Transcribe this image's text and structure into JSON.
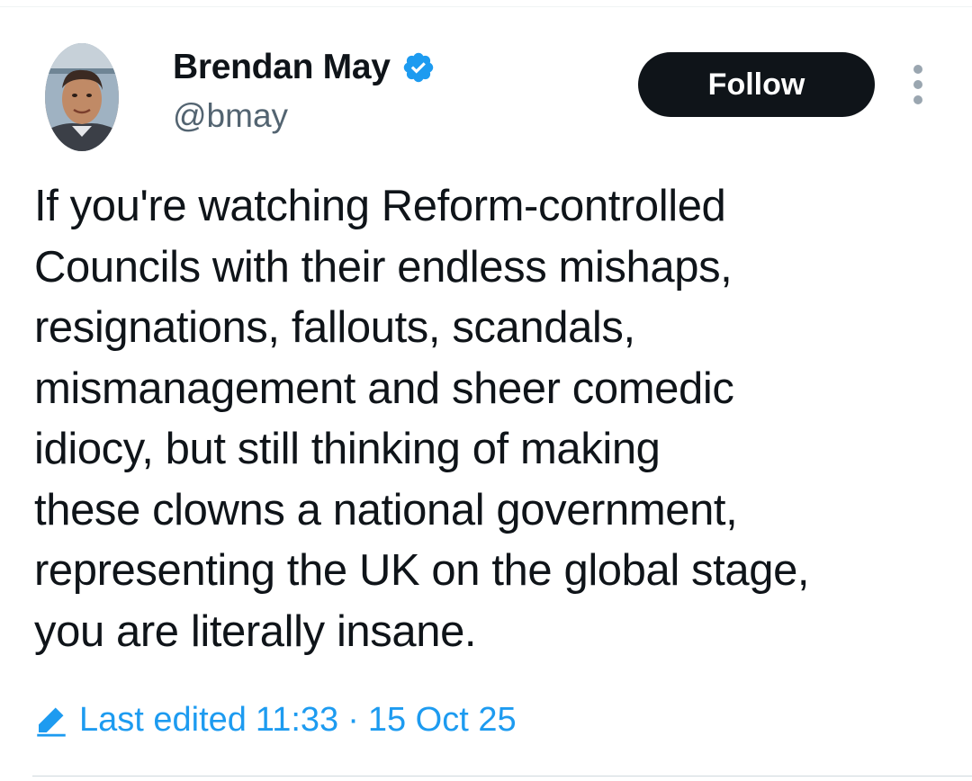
{
  "author": {
    "name": "Brendan May",
    "handle": "@bmay",
    "verified_icon": "verified-badge-icon",
    "avatar_icon": "user-avatar"
  },
  "actions": {
    "follow_label": "Follow",
    "more_icon": "more-vertical-icon"
  },
  "tweet": {
    "lines": [
      "If you're watching Reform-controlled",
      "Councils with their endless mishaps,",
      "resignations, fallouts, scandals,",
      "mismanagement and sheer comedic",
      "idiocy, but still thinking of making",
      "these clowns a national government,",
      "representing the UK on the global stage,",
      "you are literally insane."
    ]
  },
  "edit_info": {
    "icon": "pencil-icon",
    "label": "Last edited",
    "time": "11:33",
    "separator": "·",
    "date": "15 Oct 25"
  },
  "colors": {
    "accent": "#1d9bf0",
    "text": "#0f1419",
    "secondary": "#536471",
    "button_bg": "#0f1419"
  }
}
